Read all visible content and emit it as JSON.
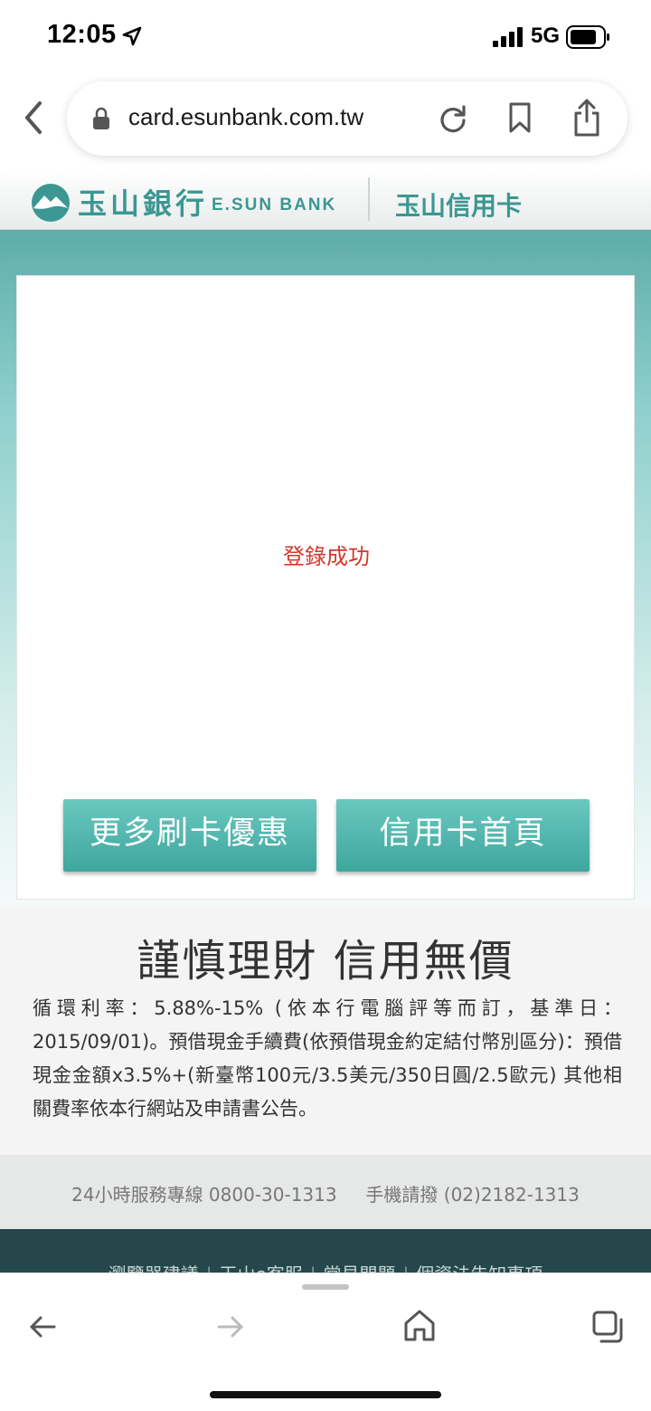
{
  "status_bar": {
    "time": "12:05",
    "network": "5G",
    "icons": [
      "location-arrow-icon",
      "signal-bars-icon",
      "battery-icon"
    ]
  },
  "browser": {
    "url": "card.esunbank.com.tw",
    "icons": [
      "back-chevron-icon",
      "lock-icon",
      "reload-icon",
      "bookmark-icon",
      "share-icon"
    ]
  },
  "header": {
    "bank_name": "玉山銀行",
    "bank_name_en": "E.SUN BANK",
    "site_title": "玉山信用卡",
    "brand_color": "#3b9792"
  },
  "main": {
    "success_message": "登錄成功",
    "success_color": "#d0392b",
    "buttons": {
      "promotions": "更多刷卡優惠",
      "card_home": "信用卡首頁"
    }
  },
  "disclaimer": {
    "slogan": "謹慎理財  信用無價",
    "rate_text": "循環利率：5.88%-15% (依本行電腦評等而訂，基準日：2015/09/01)。預借現金手續費(依預借現金約定結付幣別區分)：預借現金金額x3.5%+(新臺幣100元/3.5美元/350日圓/2.5歐元) 其他相關費率依本行網站及申請書公告。"
  },
  "hotline": {
    "service": "24小時服務專線 0800-30-1313",
    "mobile": "手機請撥 (02)2182-1313"
  },
  "footer": {
    "links": [
      "瀏覽器建議",
      "玉山e客服",
      "常見問題",
      "個資法告知事項"
    ]
  },
  "bottom_bar": {
    "icons": [
      "back-arrow-icon",
      "forward-arrow-icon",
      "home-icon",
      "tabs-icon"
    ]
  }
}
